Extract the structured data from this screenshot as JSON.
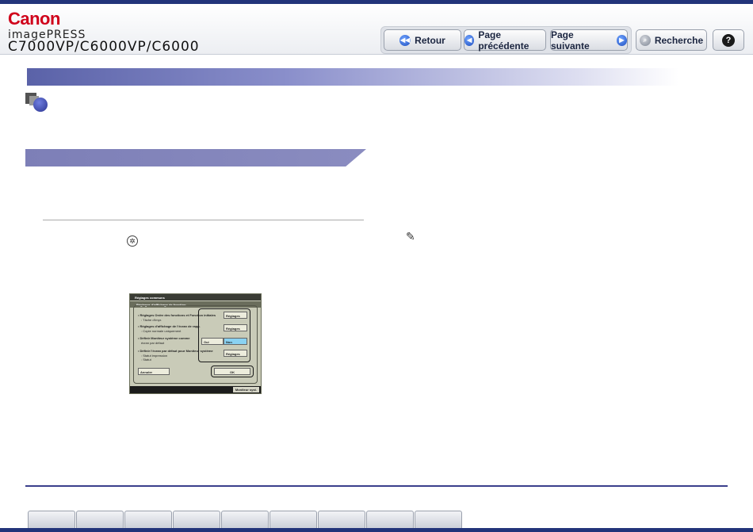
{
  "header": {
    "logo": "Canon",
    "brand": "imagePRESS",
    "model": "C7000VP/C6000VP/C6000"
  },
  "nav": {
    "back": "Retour",
    "prev": "Page précédente",
    "next": "Page suivante",
    "search": "Recherche",
    "help": "?"
  },
  "screen": {
    "title": "Réglages communs",
    "subtitle": "Réglages d'affichage de fonction",
    "row1": "• Réglages Ordre des fonctions et Fonction initiales",
    "row1b": ": Tâche d'impr.",
    "row2": "• Réglages d'affichage de l'écran de rapp.",
    "row2b": ": Copie normale uniquement",
    "row3": "• Définir Moniteur système comme",
    "row3b": "écran par défaut",
    "row4": "• Définir l'écran par défaut pour Moniteur système",
    "row4b": ": Statut impression",
    "row4c": ": Statut",
    "btn_reglages1": "Réglages",
    "btn_reglages2": "Réglages",
    "btn_oui": "Oui",
    "btn_non": "Non",
    "btn_reglages3": "Réglages",
    "btn_annuler": "Annuler",
    "btn_ok": "OK",
    "monitor": "Moniteur syst."
  },
  "tabs": [
    "",
    "",
    "",
    "",
    "",
    "",
    "",
    "",
    "",
    ""
  ]
}
